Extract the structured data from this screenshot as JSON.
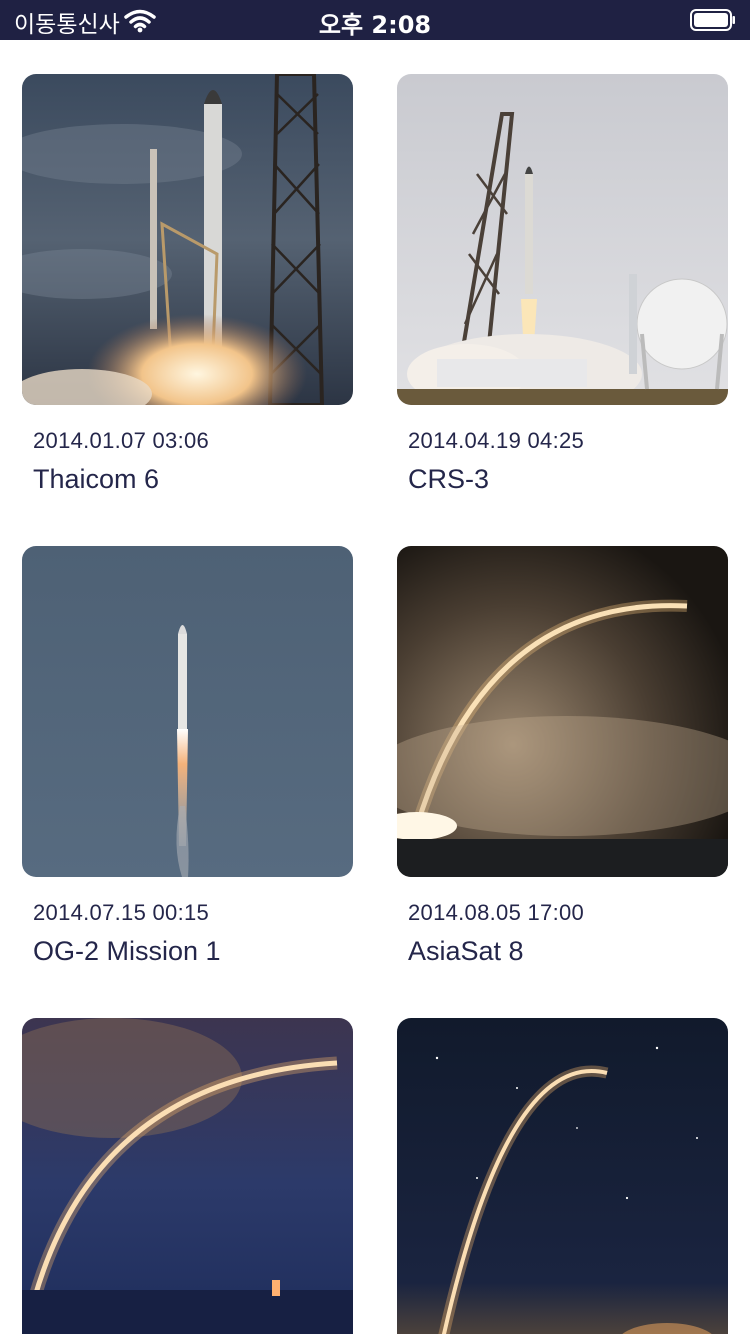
{
  "status_bar": {
    "carrier": "이동통신사",
    "time": "오후 2:08",
    "background": "#1f2143"
  },
  "launches": [
    {
      "date": "2014.01.07 03:06",
      "name": "Thaicom 6",
      "image": "rocket-liftoff-cloudy-photo"
    },
    {
      "date": "2014.04.19 04:25",
      "name": "CRS-3",
      "image": "rocket-launch-pad-photo"
    },
    {
      "date": "2014.07.15 00:15",
      "name": "OG-2 Mission 1",
      "image": "rocket-ascent-blue-sky-photo"
    },
    {
      "date": "2014.08.05 17:00",
      "name": "AsiaSat 8",
      "image": "night-launch-arc-photo"
    },
    {
      "date": "",
      "name": "",
      "image": "night-launch-arc-photo"
    },
    {
      "date": "",
      "name": "",
      "image": "night-launch-starry-photo"
    }
  ],
  "colors": {
    "text": "#24264a",
    "background": "#ffffff"
  }
}
